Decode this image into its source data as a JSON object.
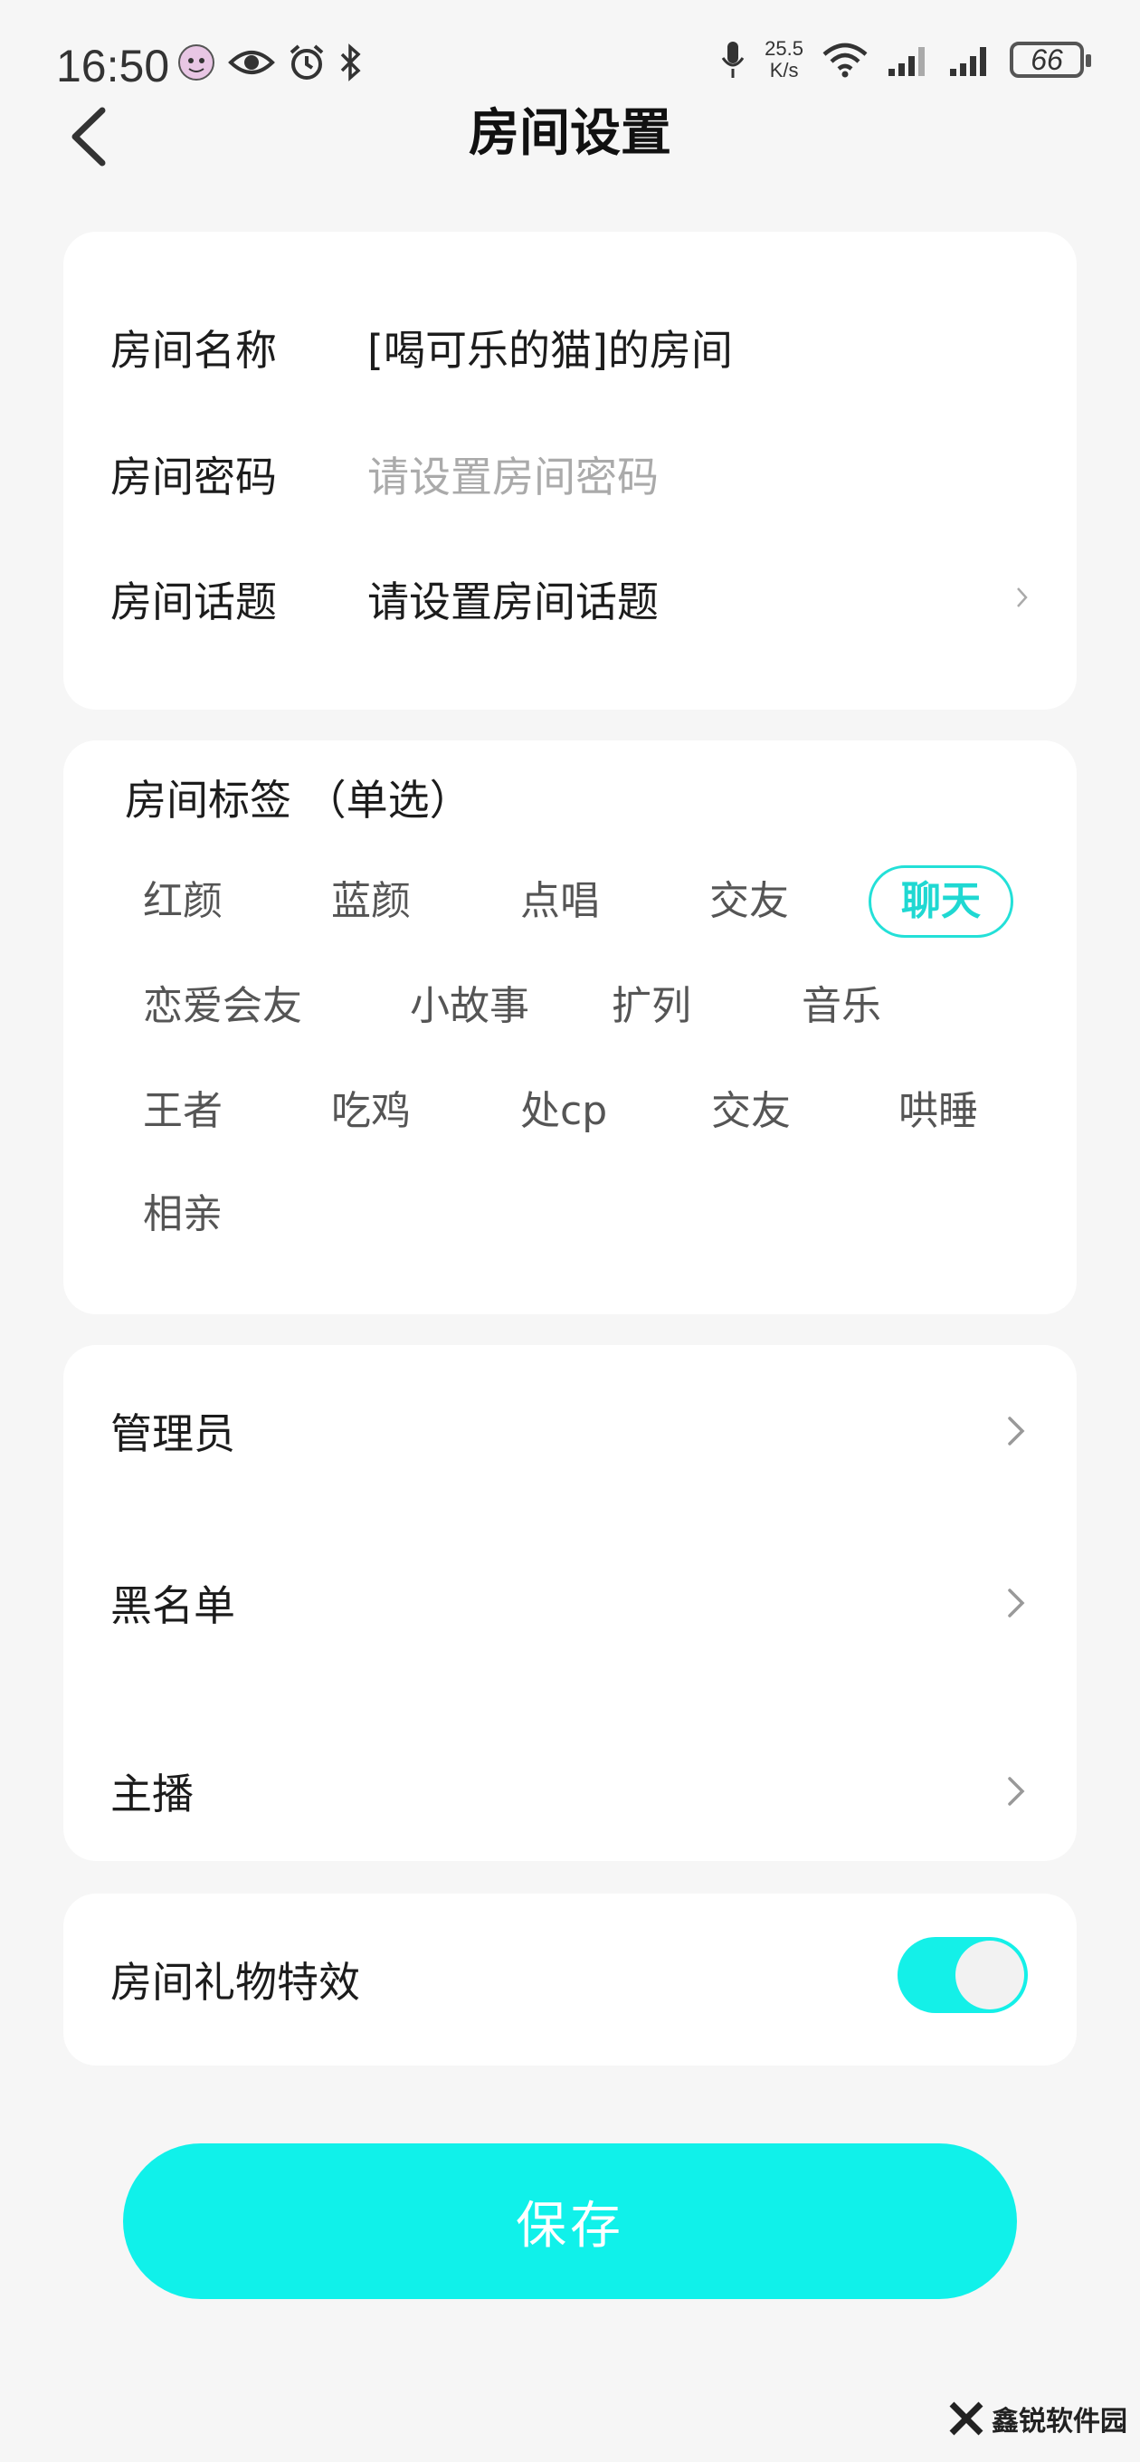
{
  "status_bar": {
    "time": "16:50",
    "net_speed_value": "25.5",
    "net_speed_unit": "K/s",
    "battery": "66"
  },
  "header": {
    "title": "房间设置"
  },
  "room_info": {
    "name_label": "房间名称",
    "name_value": "[喝可乐的猫]的房间",
    "password_label": "房间密码",
    "password_placeholder": "请设置房间密码",
    "topic_label": "房间话题",
    "topic_value": "请设置房间话题"
  },
  "tags": {
    "title": "房间标签 （单选）",
    "items": [
      {
        "label": "红颜",
        "selected": false
      },
      {
        "label": "蓝颜",
        "selected": false
      },
      {
        "label": "点唱",
        "selected": false
      },
      {
        "label": "交友",
        "selected": false
      },
      {
        "label": "聊天",
        "selected": true
      },
      {
        "label": "恋爱会友",
        "selected": false
      },
      {
        "label": "小故事",
        "selected": false
      },
      {
        "label": "扩列",
        "selected": false
      },
      {
        "label": "音乐",
        "selected": false
      },
      {
        "label": "王者",
        "selected": false
      },
      {
        "label": "吃鸡",
        "selected": false
      },
      {
        "label": "处cp",
        "selected": false
      },
      {
        "label": "交友",
        "selected": false
      },
      {
        "label": "哄睡",
        "selected": false
      },
      {
        "label": "相亲",
        "selected": false
      }
    ],
    "accent_color": "#23e0d8"
  },
  "management": {
    "admin_label": "管理员",
    "blacklist_label": "黑名单",
    "host_label": "主播"
  },
  "gift_effect": {
    "label": "房间礼物特效",
    "enabled": true
  },
  "save_button": {
    "label": "保存",
    "color": "#10f1ea"
  },
  "watermark": {
    "text": "鑫锐软件园"
  }
}
